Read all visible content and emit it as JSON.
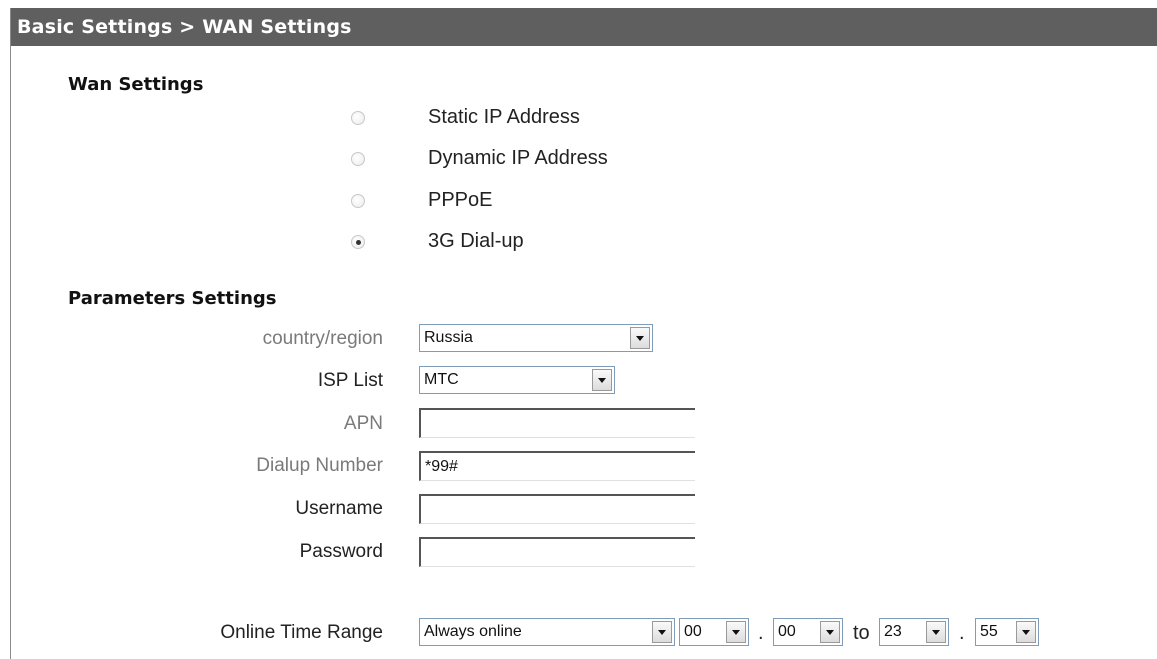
{
  "breadcrumb": "Basic Settings > WAN Settings",
  "wan": {
    "title": "Wan Settings",
    "options": [
      {
        "label": "Static IP Address",
        "checked": false
      },
      {
        "label": "Dynamic IP Address",
        "checked": false
      },
      {
        "label": "PPPoE",
        "checked": false
      },
      {
        "label": "3G Dial-up",
        "checked": true
      }
    ]
  },
  "params": {
    "title": "Parameters Settings",
    "country_label": "country/region",
    "country_value": "Russia",
    "isp_label": "ISP List",
    "isp_value": "MTC",
    "apn_label": "APN",
    "apn_value": "",
    "dialup_label": "Dialup Number",
    "dialup_value": "*99#",
    "username_label": "Username",
    "username_value": "",
    "password_label": "Password",
    "password_value": "",
    "online_label": "Online Time Range",
    "online_mode": "Always online",
    "start_hour": "00",
    "start_min": "00",
    "to_label": "to",
    "end_hour": "23",
    "end_min": "55",
    "time_sep": "."
  }
}
